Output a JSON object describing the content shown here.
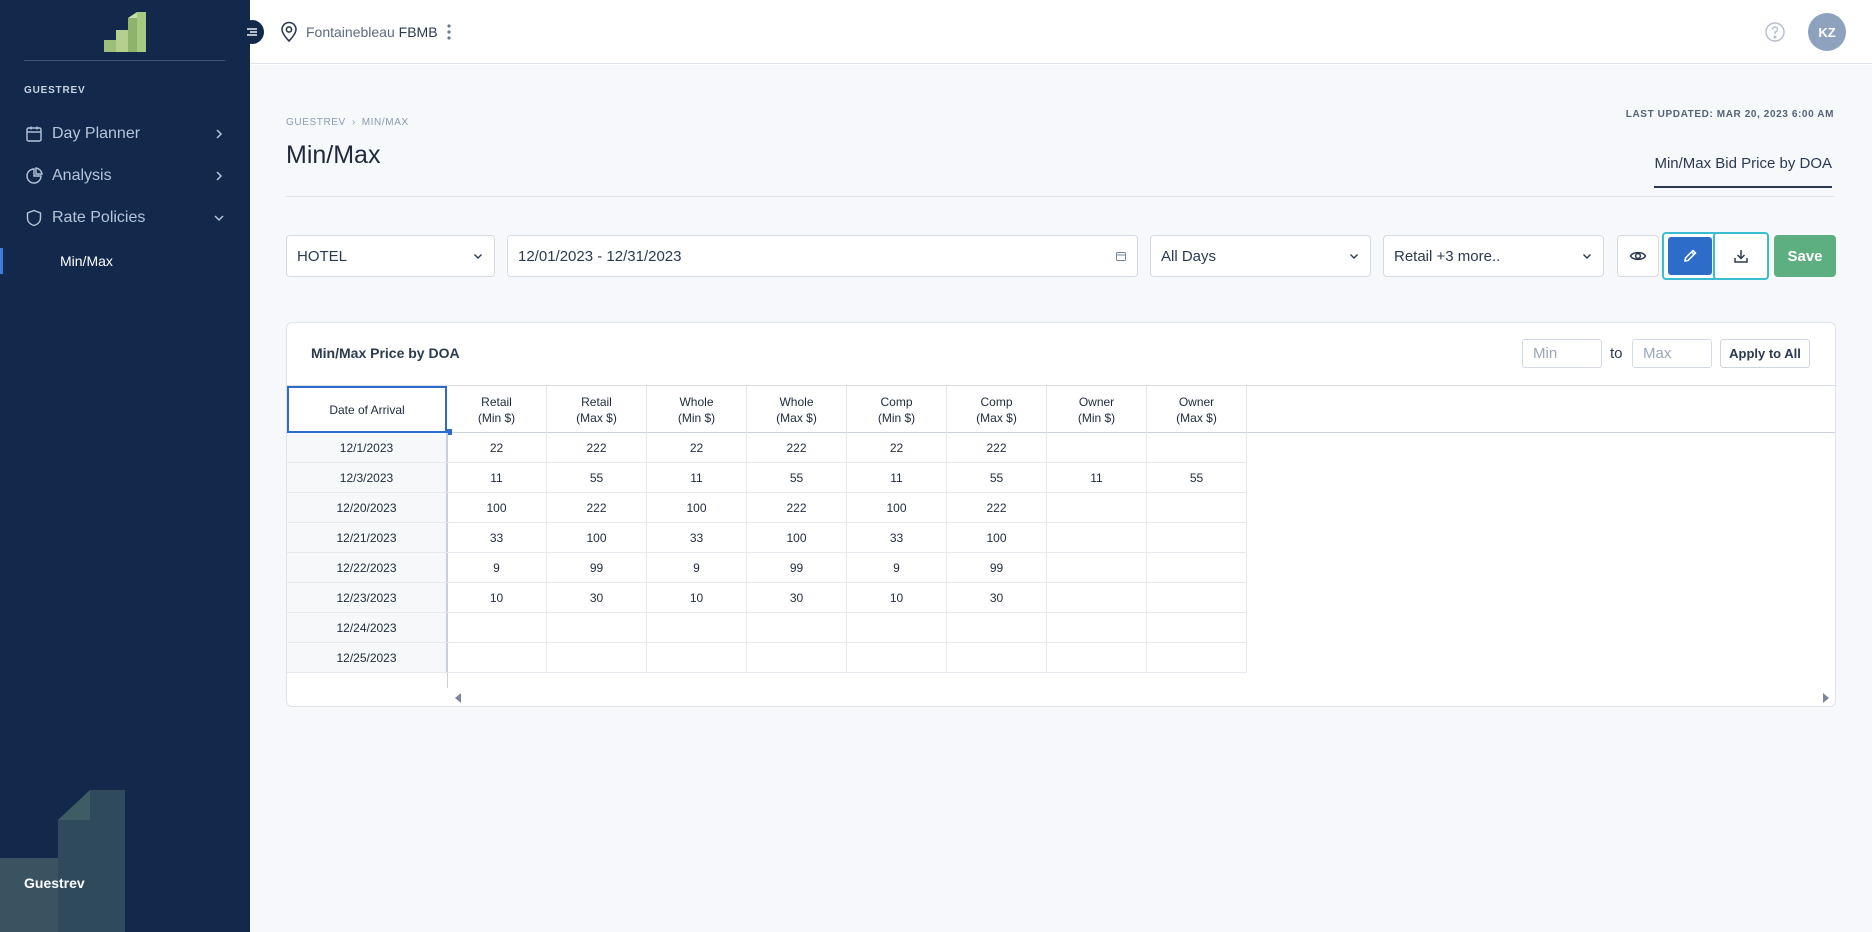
{
  "sidebar": {
    "section_label": "GUESTREV",
    "items": [
      {
        "label": "Day Planner",
        "icon": "calendar-icon"
      },
      {
        "label": "Analysis",
        "icon": "pie-chart-icon"
      },
      {
        "label": "Rate Policies",
        "icon": "shield-icon"
      }
    ],
    "sub_item": "Min/Max",
    "footer": "Guestrev"
  },
  "topbar": {
    "location_prefix": "Fontainebleau",
    "location_code": "FBMB",
    "avatar": "KZ"
  },
  "page": {
    "breadcrumb": [
      "GUESTREV",
      "MIN/MAX"
    ],
    "title": "Min/Max",
    "last_updated": "LAST UPDATED: MAR 20, 2023 6:00 AM",
    "tab": "Min/Max Bid Price by DOA"
  },
  "filters": {
    "property": "HOTEL",
    "date_range": "12/01/2023 - 12/31/2023",
    "days": "All Days",
    "segments": "Retail +3 more..",
    "save_label": "Save"
  },
  "card": {
    "title": "Min/Max Price by DOA",
    "min_placeholder": "Min",
    "to_label": "to",
    "max_placeholder": "Max",
    "apply_label": "Apply to All"
  },
  "table": {
    "headers": [
      "Date of Arrival",
      "Retail\n(Min $)",
      "Retail\n(Max $)",
      "Whole\n(Min $)",
      "Whole\n(Max $)",
      "Comp\n(Min $)",
      "Comp\n(Max $)",
      "Owner\n(Min $)",
      "Owner\n(Max $)"
    ],
    "rows": [
      [
        "12/1/2023",
        "22",
        "222",
        "22",
        "222",
        "22",
        "222",
        "",
        ""
      ],
      [
        "12/3/2023",
        "11",
        "55",
        "11",
        "55",
        "11",
        "55",
        "11",
        "55"
      ],
      [
        "12/20/2023",
        "100",
        "222",
        "100",
        "222",
        "100",
        "222",
        "",
        ""
      ],
      [
        "12/21/2023",
        "33",
        "100",
        "33",
        "100",
        "33",
        "100",
        "",
        ""
      ],
      [
        "12/22/2023",
        "9",
        "99",
        "9",
        "99",
        "9",
        "99",
        "",
        ""
      ],
      [
        "12/23/2023",
        "10",
        "30",
        "10",
        "30",
        "10",
        "30",
        "",
        ""
      ],
      [
        "12/24/2023",
        "",
        "",
        "",
        "",
        "",
        "",
        "",
        ""
      ],
      [
        "12/25/2023",
        "",
        "",
        "",
        "",
        "",
        "",
        "",
        ""
      ]
    ]
  },
  "colors": {
    "sidebar_bg": "#13294b",
    "accent_blue": "#2d6cc9",
    "save_green": "#5dae80",
    "highlight_cyan": "#3bbcd0"
  }
}
